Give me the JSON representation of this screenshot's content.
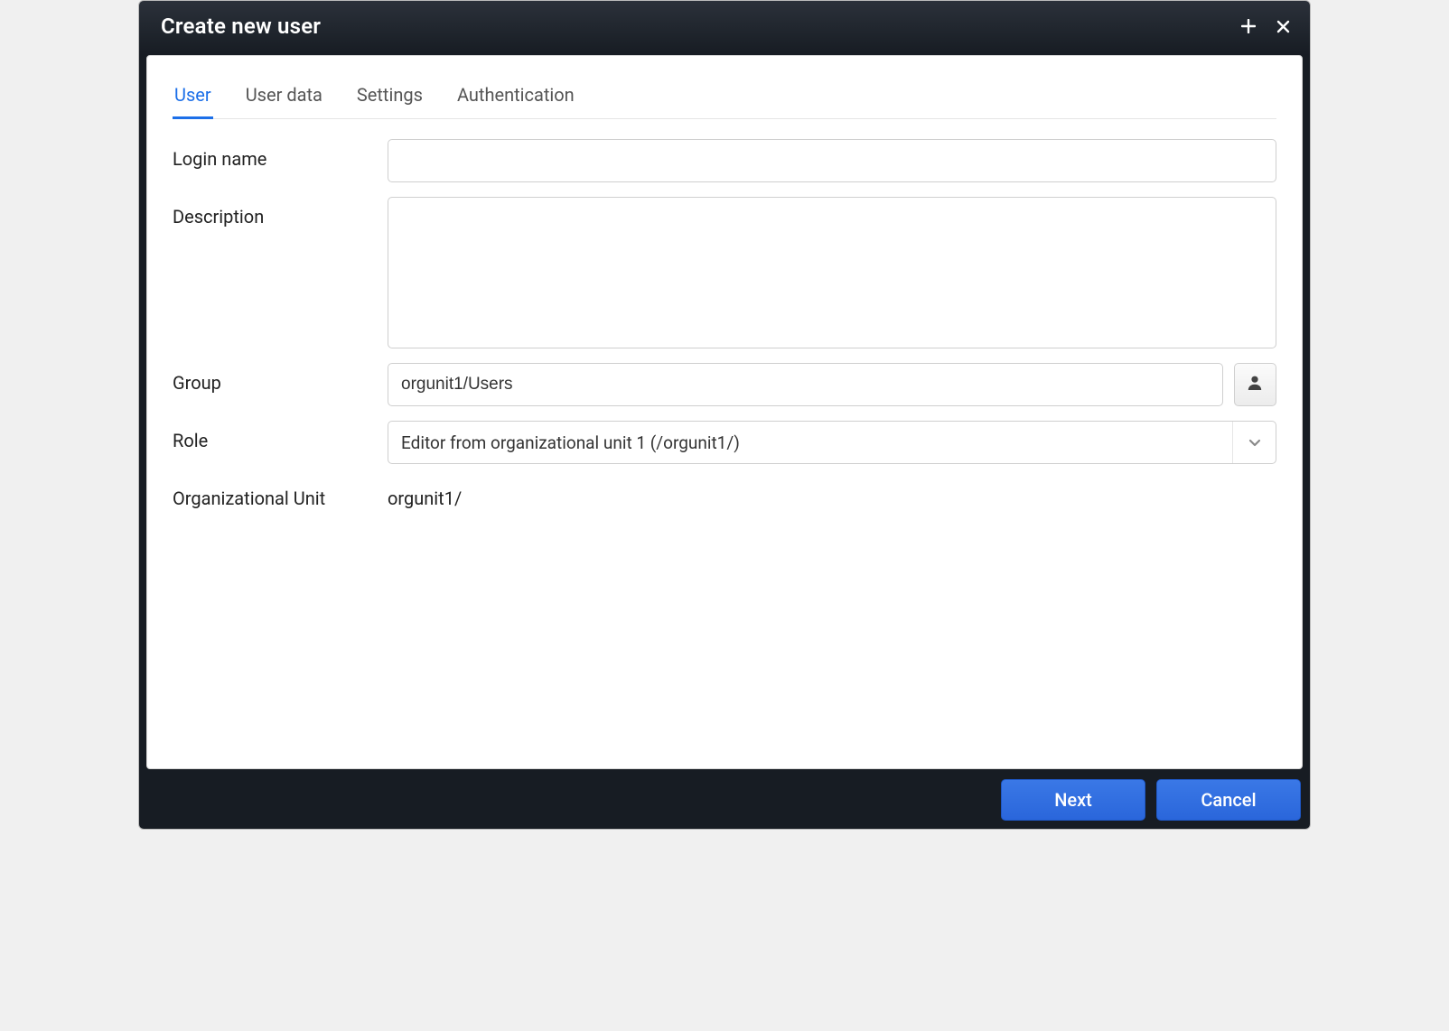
{
  "titlebar": {
    "title": "Create new user"
  },
  "tabs": [
    {
      "label": "User",
      "active": true
    },
    {
      "label": "User data",
      "active": false
    },
    {
      "label": "Settings",
      "active": false
    },
    {
      "label": "Authentication",
      "active": false
    }
  ],
  "form": {
    "login_name": {
      "label": "Login name",
      "value": ""
    },
    "description": {
      "label": "Description",
      "value": ""
    },
    "group": {
      "label": "Group",
      "value": "orgunit1/Users"
    },
    "role": {
      "label": "Role",
      "value": "Editor from organizational unit 1 (/orgunit1/)"
    },
    "org_unit": {
      "label": "Organizational Unit",
      "value": "orgunit1/"
    }
  },
  "footer": {
    "next_label": "Next",
    "cancel_label": "Cancel"
  }
}
